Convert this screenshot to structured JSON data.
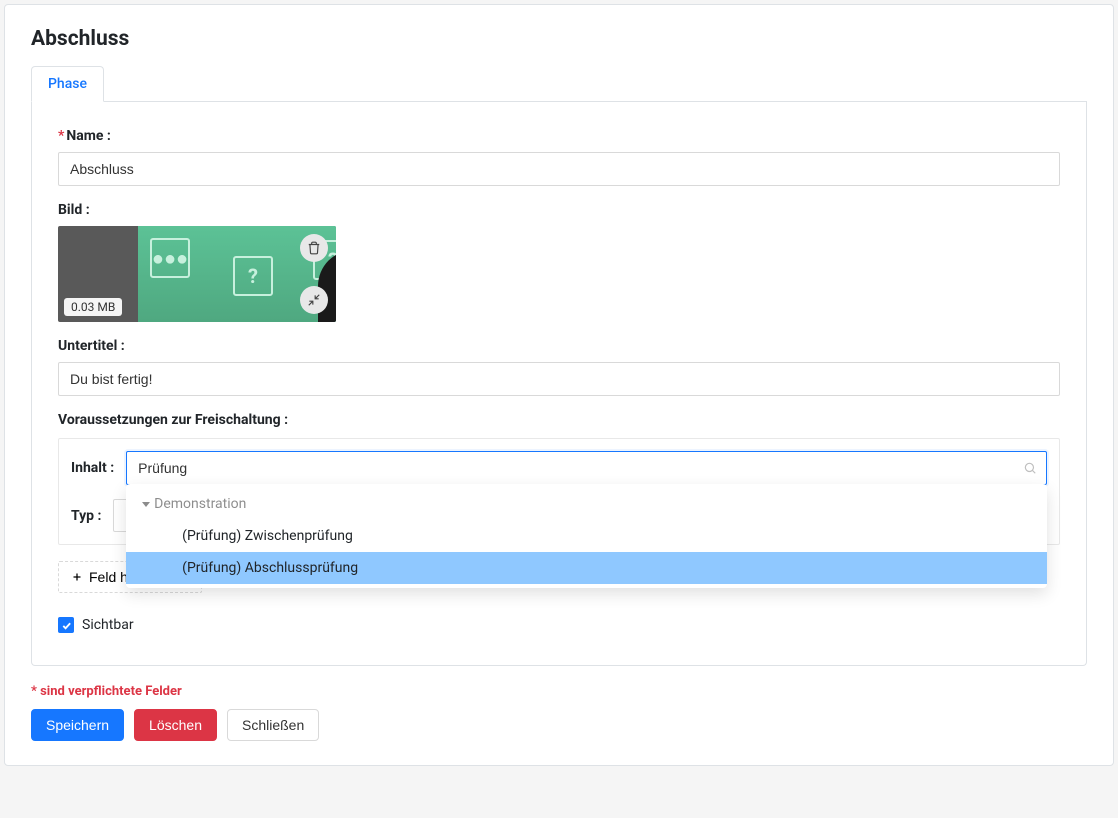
{
  "page_title": "Abschluss",
  "tabs": {
    "phase": "Phase"
  },
  "form": {
    "name_label": "Name :",
    "name_value": "Abschluss",
    "bild_label": "Bild :",
    "image_size": "0.03 MB",
    "subtitle_label": "Untertitel :",
    "subtitle_value": "Du bist fertig!",
    "prereq_label": "Voraussetzungen zur Freischaltung :",
    "inhalt_label": "Inhalt :",
    "inhalt_search": "Prüfung",
    "typ_label": "Typ :",
    "add_field": "Feld hinzufügen",
    "visible_label": "Sichtbar"
  },
  "dropdown": {
    "group": "Demonstration",
    "option1": "(Prüfung) Zwischenprüfung",
    "option2": "(Prüfung) Abschlussprüfung"
  },
  "required_note": "* sind verpflichtete Felder",
  "buttons": {
    "save": "Speichern",
    "delete": "Löschen",
    "close": "Schließen"
  }
}
